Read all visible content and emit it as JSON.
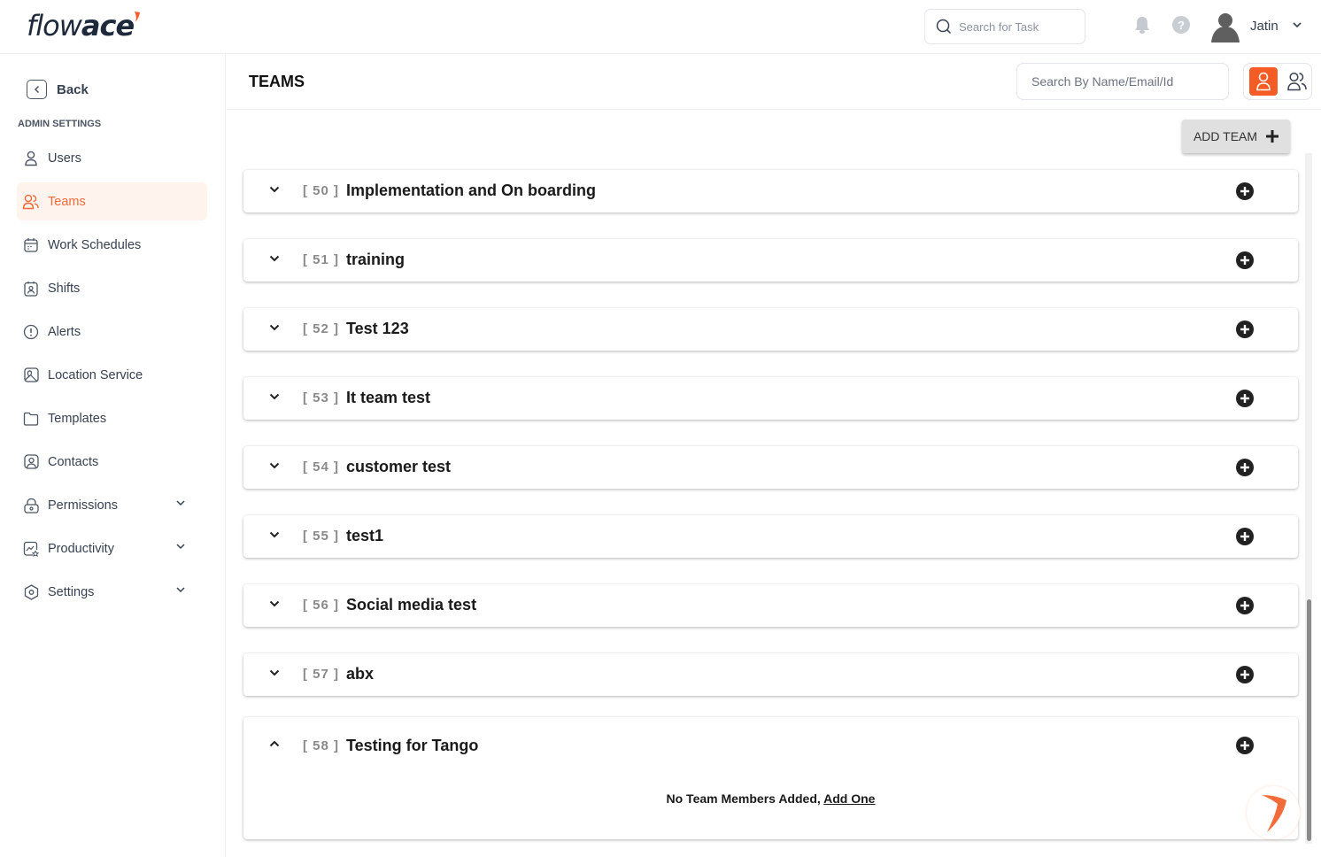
{
  "header": {
    "logo_light": "flow",
    "logo_bold": "ace",
    "task_search_placeholder": "Search for Task",
    "user_name": "Jatin",
    "help_label": "?"
  },
  "sidebar": {
    "back_label": "Back",
    "section_label": "ADMIN SETTINGS",
    "items": [
      {
        "label": "Users",
        "icon": "user-icon",
        "active": false,
        "expandable": false
      },
      {
        "label": "Teams",
        "icon": "users-icon",
        "active": true,
        "expandable": false
      },
      {
        "label": "Work Schedules",
        "icon": "calendar-icon",
        "active": false,
        "expandable": false
      },
      {
        "label": "Shifts",
        "icon": "shift-badge-icon",
        "active": false,
        "expandable": false
      },
      {
        "label": "Alerts",
        "icon": "alert-circle-icon",
        "active": false,
        "expandable": false
      },
      {
        "label": "Location Service",
        "icon": "map-pin-icon",
        "active": false,
        "expandable": false
      },
      {
        "label": "Templates",
        "icon": "folder-icon",
        "active": false,
        "expandable": false
      },
      {
        "label": "Contacts",
        "icon": "contact-icon",
        "active": false,
        "expandable": false
      },
      {
        "label": "Permissions",
        "icon": "lock-icon",
        "active": false,
        "expandable": true
      },
      {
        "label": "Productivity",
        "icon": "productivity-icon",
        "active": false,
        "expandable": true
      },
      {
        "label": "Settings",
        "icon": "settings-hex-icon",
        "active": false,
        "expandable": true
      }
    ]
  },
  "main": {
    "title": "TEAMS",
    "member_search_placeholder": "Search By Name/Email/Id",
    "add_team_label": "ADD TEAM",
    "colors": {
      "accent": "#f45b25",
      "active_bg": "#fff3ee",
      "active_text": "#f26b3a"
    },
    "teams": [
      {
        "id": "[ 50 ]",
        "name": "Implementation and On boarding",
        "expanded": false
      },
      {
        "id": "[ 51 ]",
        "name": "training",
        "expanded": false
      },
      {
        "id": "[ 52 ]",
        "name": "Test 123",
        "expanded": false
      },
      {
        "id": "[ 53 ]",
        "name": "It team test",
        "expanded": false
      },
      {
        "id": "[ 54 ]",
        "name": "customer test",
        "expanded": false
      },
      {
        "id": "[ 55 ]",
        "name": "test1",
        "expanded": false
      },
      {
        "id": "[ 56 ]",
        "name": "Social media test",
        "expanded": false
      },
      {
        "id": "[ 57 ]",
        "name": "abx",
        "expanded": false
      },
      {
        "id": "[ 58 ]",
        "name": "Testing for Tango",
        "expanded": true,
        "empty_text": "No Team Members Added,",
        "empty_link": "Add One"
      }
    ]
  }
}
